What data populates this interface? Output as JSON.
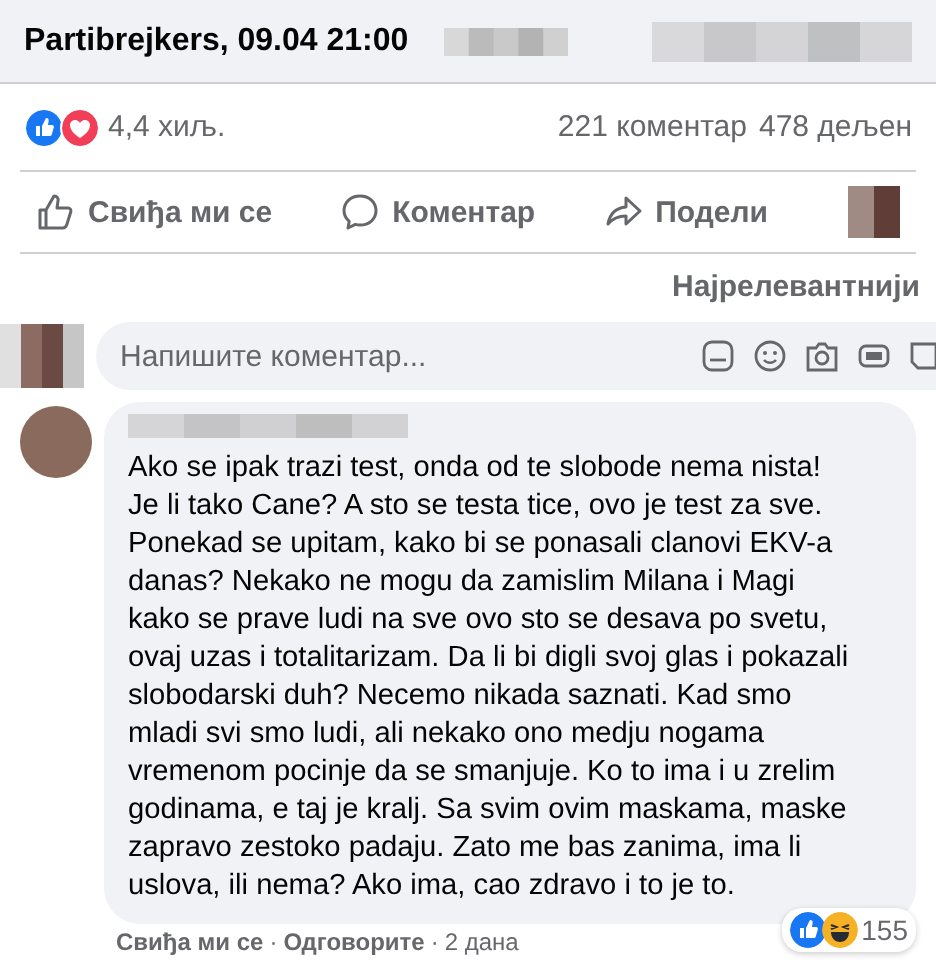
{
  "post": {
    "title": "Partibrejkers, 09.04 21:00"
  },
  "stats": {
    "reactions": [
      {
        "kind": "like"
      },
      {
        "kind": "love"
      }
    ],
    "reaction_count": "4,4 хиљ.",
    "comments": "221 коментар",
    "shares": "478 дељен"
  },
  "actions": [
    {
      "kind": "like",
      "label": "Свиђа ми се"
    },
    {
      "kind": "comment",
      "label": "Коментар"
    },
    {
      "kind": "share",
      "label": "Подели"
    }
  ],
  "sort": {
    "label": "Најрелевантнији"
  },
  "comment_input": {
    "placeholder": "Напишите коментар..."
  },
  "comment": {
    "text": "Ako se ipak trazi test, onda od te slobode nema nista! Je li tako Cane? A sto se testa tice, ovo je test za sve. Ponekad se upitam, kako bi se ponasali clanovi EKV-a danas? Nekako ne mogu da zamislim Milana i Magi kako se prave ludi na sve ovo sto se desava po svetu, ovaj uzas i totalitarizam. Da li bi digli svoj glas i pokazali slobodarski duh? Necemo nikada saznati. Kad smo mladi svi smo ludi, ali nekako ono medju nogama vremenom pocinje da se smanjuje. Ko to ima i u zrelim godinama, e taj je kralj. Sa svim ovim maskama, maske zapravo zestoko padaju. Zato me bas zanima, ima li uslova, ili nema? Ako ima, cao zdravo i to je to.",
    "reactions": [
      {
        "kind": "like"
      },
      {
        "kind": "haha"
      }
    ],
    "reaction_count": "155",
    "footer": [
      {
        "kind": "link",
        "text": "Свиђа ми се"
      },
      {
        "kind": "sep",
        "text": "·"
      },
      {
        "kind": "link",
        "text": "Одговорите"
      },
      {
        "kind": "sep",
        "text": "·"
      },
      {
        "kind": "time",
        "text": "2 дана"
      }
    ]
  }
}
